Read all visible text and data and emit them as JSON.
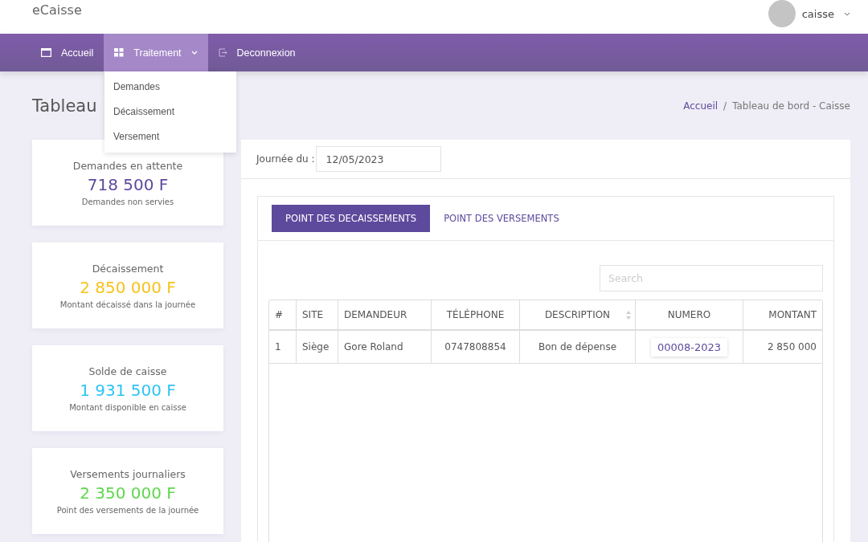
{
  "header": {
    "brand": "eCaisse",
    "user": "caisse"
  },
  "nav": {
    "items": [
      {
        "label": "Accueil",
        "selected": false,
        "caret": false
      },
      {
        "label": "Traitement",
        "selected": true,
        "caret": true
      },
      {
        "label": "Deconnexion",
        "selected": false,
        "caret": false
      }
    ],
    "dropdown": [
      "Demandes",
      "Décaissement",
      "Versement"
    ]
  },
  "page_title": "Tableau",
  "breadcrumb": {
    "separator": "/",
    "items": [
      {
        "label": "Accueil",
        "link": true
      },
      {
        "label": "Tableau de bord - Caisse",
        "link": false
      }
    ]
  },
  "cards": [
    {
      "title": "Demandes en attente",
      "amount": "718 500 F",
      "color": "#5e4a9c",
      "note": "Demandes non servies"
    },
    {
      "title": "Décaissement",
      "amount": "2 850 000 F",
      "color": "#f8c21a",
      "note": "Montant décaissé dans la journée"
    },
    {
      "title": "Solde de caisse",
      "amount": "1 931 500 F",
      "color": "#2ec3f5",
      "note": "Montant disponible en caisse"
    },
    {
      "title": "Versements journaliers",
      "amount": "2 350 000 F",
      "color": "#5ed84c",
      "note": "Point des versements de la journée"
    }
  ],
  "date_filter": {
    "label": "Journée du :",
    "value": "12/05/2023"
  },
  "tabs": [
    {
      "label": "POINT DES DECAISSEMENTS",
      "selected": true
    },
    {
      "label": "POINT DES VERSEMENTS",
      "selected": false
    }
  ],
  "search": {
    "placeholder": "Search"
  },
  "table": {
    "columns": [
      {
        "label": "#",
        "sortable": false
      },
      {
        "label": "SITE",
        "sortable": false
      },
      {
        "label": "DEMANDEUR",
        "sortable": false
      },
      {
        "label": "TÉLÉPHONE",
        "sortable": false
      },
      {
        "label": "DESCRIPTION",
        "sortable": true
      },
      {
        "label": "NUMERO",
        "sortable": false
      },
      {
        "label": "MONTANT",
        "sortable": false
      }
    ],
    "rows": [
      [
        "1",
        "Siège",
        "Gore Roland",
        "0747808854",
        "Bon de dépense",
        "00008-2023",
        "2 850 000"
      ]
    ]
  }
}
